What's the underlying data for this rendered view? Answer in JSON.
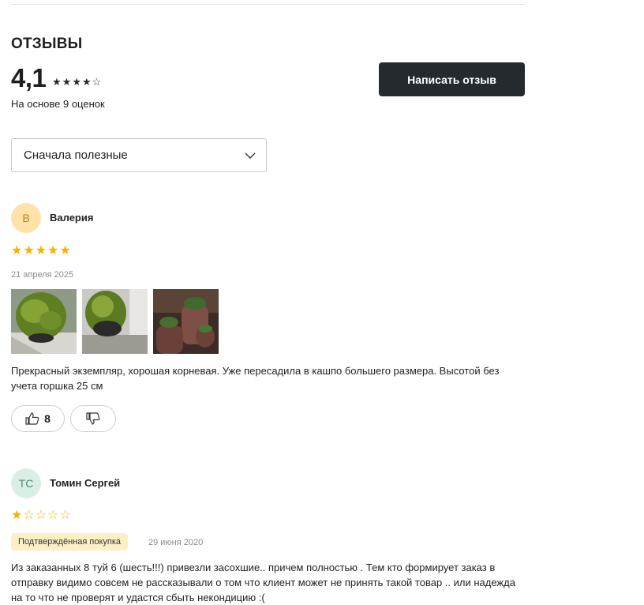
{
  "reviews_section": {
    "title": "ОТЗЫВЫ",
    "average_rating": "4,1",
    "rating_stars_filled": 4,
    "rating_stars_total": 5,
    "based_on": "На основе 9 оценок",
    "write_review_label": "Написать отзыв",
    "sort_selected": "Сначала полезные"
  },
  "reviews": [
    {
      "avatar_initials": "В",
      "avatar_bg": "#fde3a7",
      "avatar_color": "#c47a1e",
      "author": "Валерия",
      "stars": 5,
      "date": "21 апреля 2025",
      "text": "Прекрасный экземпляр, хорошая корневая. Уже пересадила в кашпо большего размера. Высотой без учета горшка 25 см",
      "likes": "8"
    },
    {
      "avatar_initials": "ТС",
      "avatar_bg": "#d9efe5",
      "avatar_color": "#5a8a73",
      "author": "Томин Сергей",
      "stars": 1,
      "badge": "Подтверждённая покупка",
      "date": "29 июня 2020",
      "text": "Из заказанных 8 туй 6 (шесть!!!) привезли засохшие.. причем полностью . Тем кто формирует заказ в отправку видимо совсем не рассказывали о том что клиент может не принять такой товар .. или надежда на то что не проверят и удастся сбыть некондицию :("
    }
  ],
  "colors": {
    "button_bg": "#242a2e",
    "star": "#f5b301",
    "badge_bg": "#fbefc4"
  }
}
